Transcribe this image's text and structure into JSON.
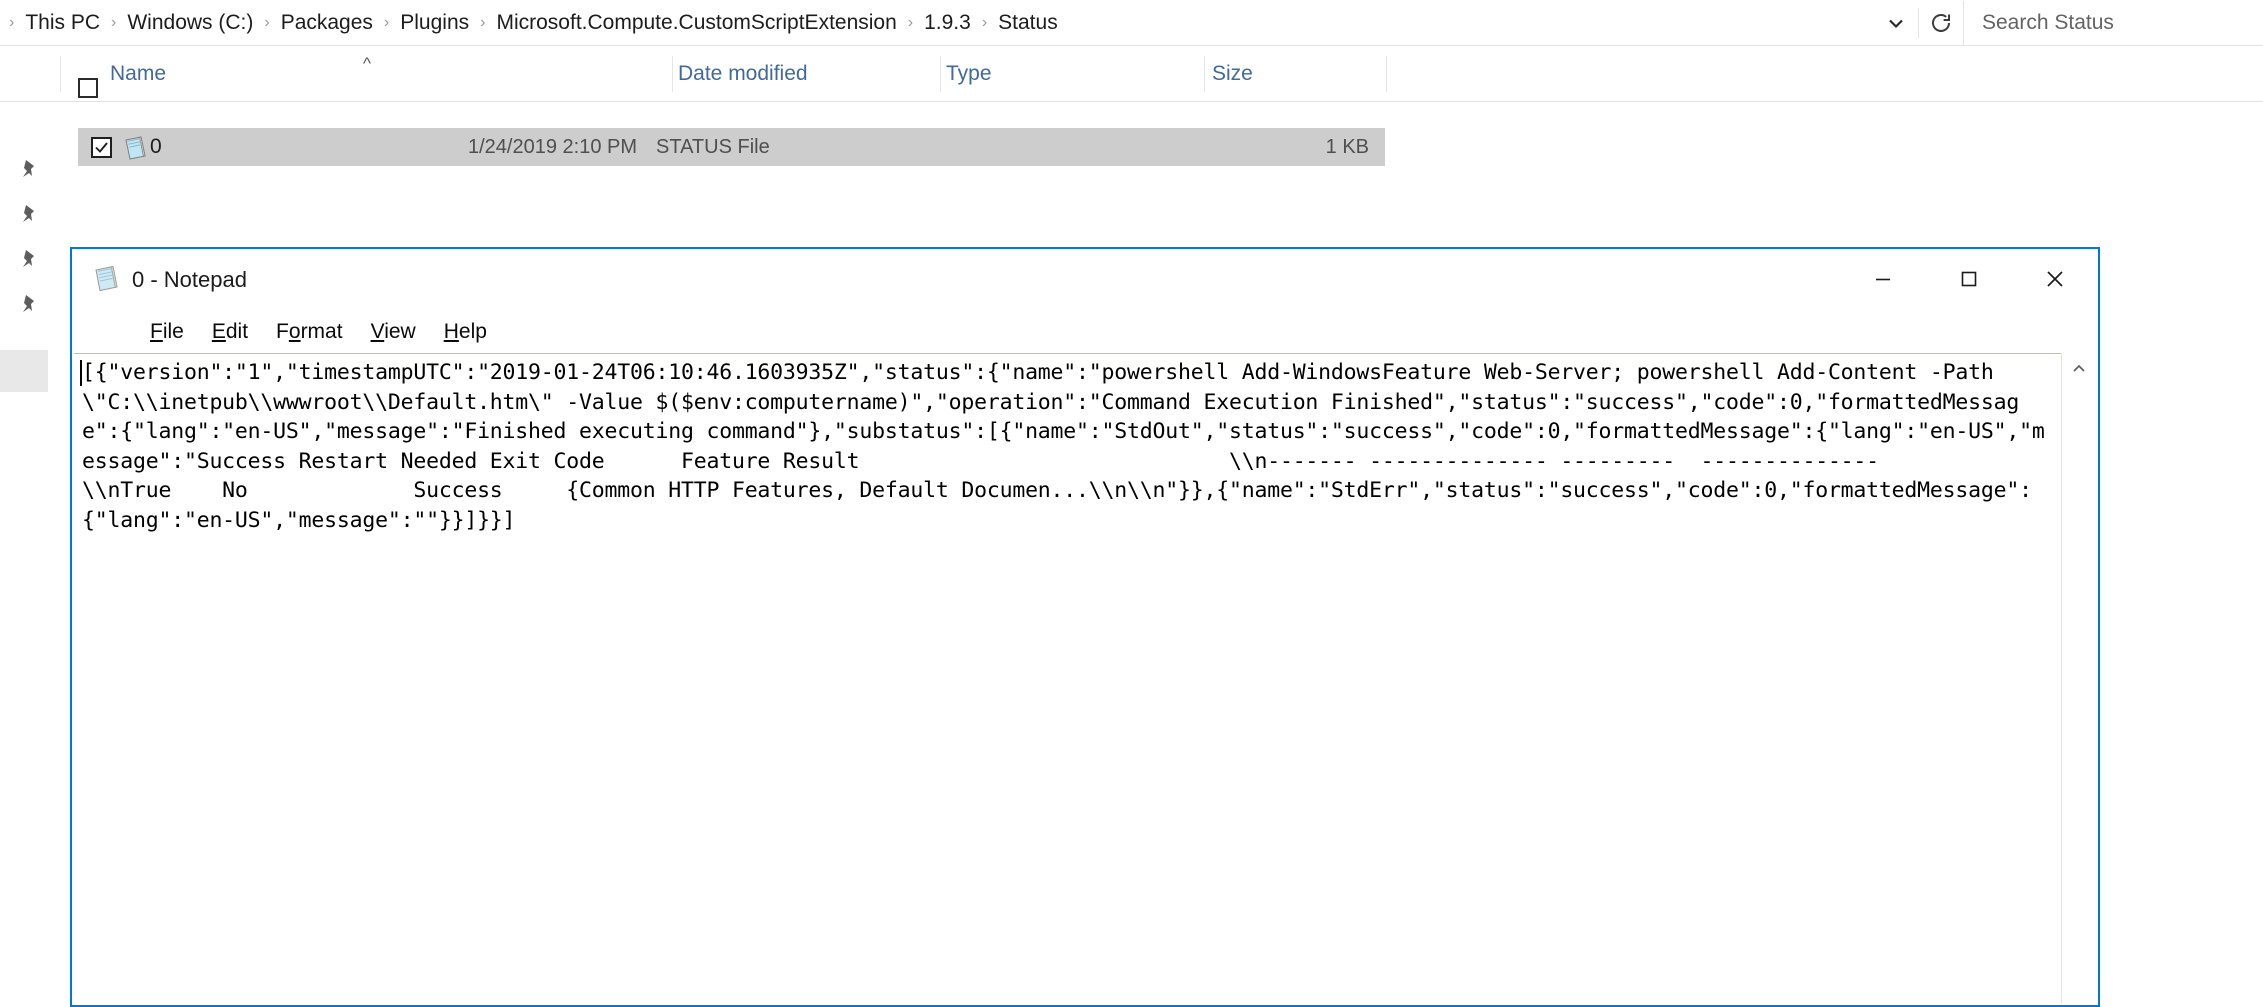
{
  "explorer": {
    "breadcrumb": {
      "leading_separator": "›",
      "items": [
        "This PC",
        "Windows (C:)",
        "Packages",
        "Plugins",
        "Microsoft.Compute.CustomScriptExtension",
        "1.9.3",
        "Status"
      ],
      "separator": "›"
    },
    "address_dropdown_icon": "chevron-down-icon",
    "refresh_icon": "refresh-icon",
    "search": {
      "placeholder": "Search Status"
    },
    "columns": [
      {
        "label": "Name",
        "sort": "ascending",
        "sort_caret": "^"
      },
      {
        "label": "Date modified"
      },
      {
        "label": "Type"
      },
      {
        "label": "Size"
      }
    ],
    "rows": [
      {
        "name": "0",
        "date_modified": "1/24/2019 2:10 PM",
        "type": "STATUS File",
        "size": "1 KB",
        "checked": true,
        "icon": "notepad-file-icon"
      }
    ]
  },
  "notepad": {
    "title": "0 - Notepad",
    "icon": "notepad-icon",
    "window_controls": {
      "minimize": "minimize-icon",
      "maximize": "maximize-icon",
      "close": "close-icon"
    },
    "menus": [
      {
        "label": "File",
        "accel": "F"
      },
      {
        "label": "Edit",
        "accel": "E"
      },
      {
        "label": "Format",
        "accel": "o"
      },
      {
        "label": "View",
        "accel": "V"
      },
      {
        "label": "Help",
        "accel": "H"
      }
    ],
    "content": "[{\"version\":\"1\",\"timestampUTC\":\"2019-01-24T06:10:46.1603935Z\",\"status\":{\"name\":\"powershell Add-WindowsFeature Web-Server; powershell Add-Content -Path \\\"C:\\\\inetpub\\\\wwwroot\\\\Default.htm\\\" -Value $($env:computername)\",\"operation\":\"Command Execution Finished\",\"status\":\"success\",\"code\":0,\"formattedMessage\":{\"lang\":\"en-US\",\"message\":\"Finished executing command\"},\"substatus\":[{\"name\":\"StdOut\",\"status\":\"success\",\"code\":0,\"formattedMessage\":{\"lang\":\"en-US\",\"message\":\"Success Restart Needed Exit Code      Feature Result                             \\\\n------- -------------- ---------  --------------                            \\\\nTrue    No             Success     {Common HTTP Features, Default Documen...\\\\n\\\\n\"}},{\"name\":\"StdErr\",\"status\":\"success\",\"code\":0,\"formattedMessage\":{\"lang\":\"en-US\",\"message\":\"\"}}]}}]",
    "scroll_up_icon": "scroll-up-icon"
  }
}
